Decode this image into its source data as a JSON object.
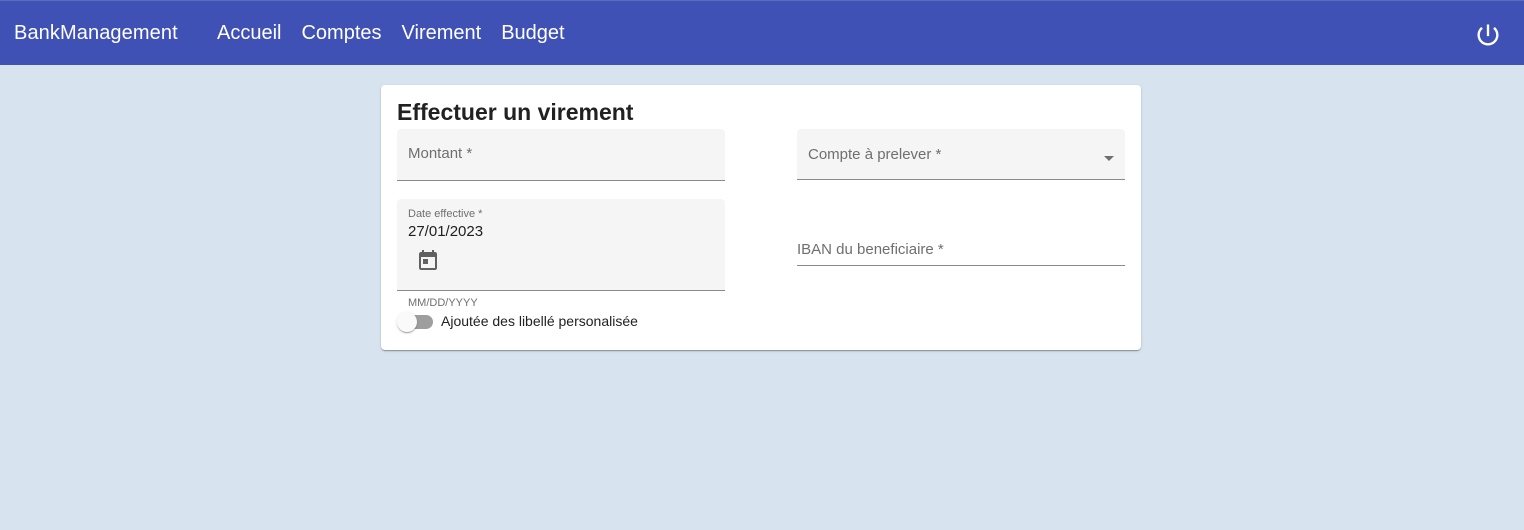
{
  "app": {
    "brand": "BankManagement",
    "nav": [
      "Accueil",
      "Comptes",
      "Virement",
      "Budget"
    ],
    "logout_icon": "power-icon",
    "toolbar_color": "#3f51b5"
  },
  "form": {
    "title": "Effectuer un virement",
    "montant": {
      "label": "Montant *",
      "value": ""
    },
    "compte": {
      "label": "Compte à prelever *",
      "value": "",
      "icon": "dropdown-arrow-icon"
    },
    "date": {
      "label": "Date effective *",
      "value": "27/01/2023",
      "hint": "MM/DD/YYYY",
      "icon": "calendar-icon"
    },
    "iban": {
      "label": "IBAN du beneficiaire *",
      "value": ""
    },
    "toggle": {
      "label": "Ajoutée des libellé personalisée",
      "checked": false
    }
  }
}
